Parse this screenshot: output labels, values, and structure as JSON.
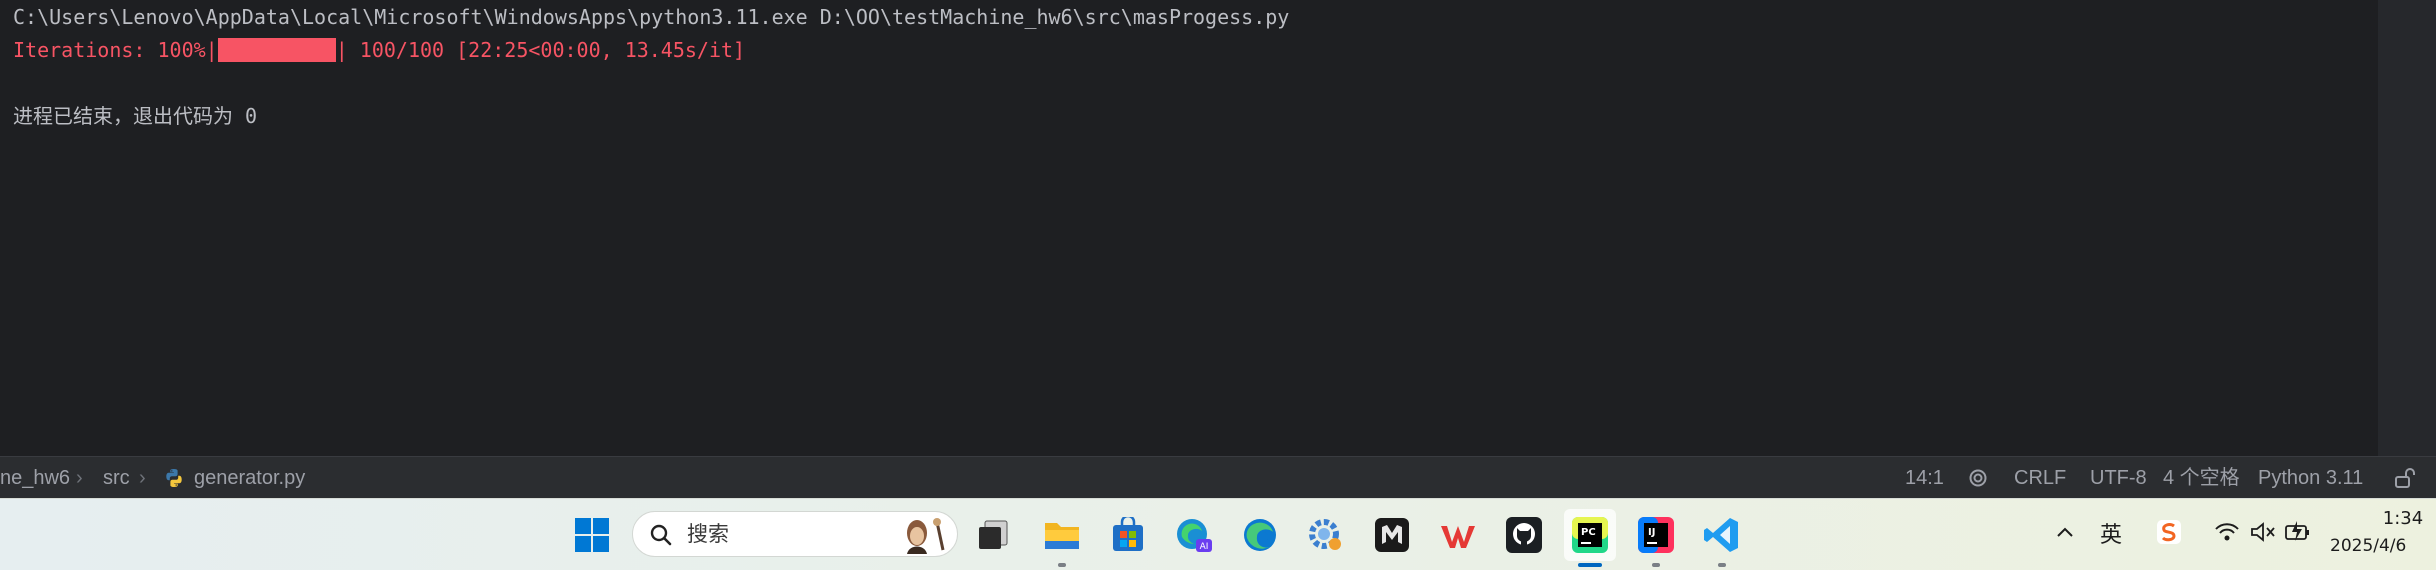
{
  "console": {
    "command_line": "C:\\Users\\Lenovo\\AppData\\Local\\Microsoft\\WindowsApps\\python3.11.exe D:\\OO\\testMachine_hw6\\src\\masProgess.py",
    "progress": {
      "prefix": "Iterations: 100%|",
      "bar_fill_fraction": 1.0,
      "suffix": "| 100/100 [22:25<00:00, 13.45s/it]"
    },
    "exit_message": "进程已结束，退出代码为 0"
  },
  "status_bar": {
    "breadcrumb_project": "ne_hw6",
    "breadcrumb_folder": "src",
    "breadcrumb_file": "generator.py",
    "cursor_position": "14:1",
    "line_separator": "CRLF",
    "encoding": "UTF-8",
    "indent": "4 个空格",
    "interpreter": "Python 3.11"
  },
  "taskbar": {
    "search_placeholder": "搜索",
    "input_mode": "英",
    "clock_time": "1:34",
    "clock_date": "2025/4/6"
  },
  "colors": {
    "console_bg": "#1e1f22",
    "console_text": "#bcbec4",
    "progress_red": "#f75464",
    "status_bar_bg": "#2b2d30",
    "windows_blue": "#0078d4"
  }
}
